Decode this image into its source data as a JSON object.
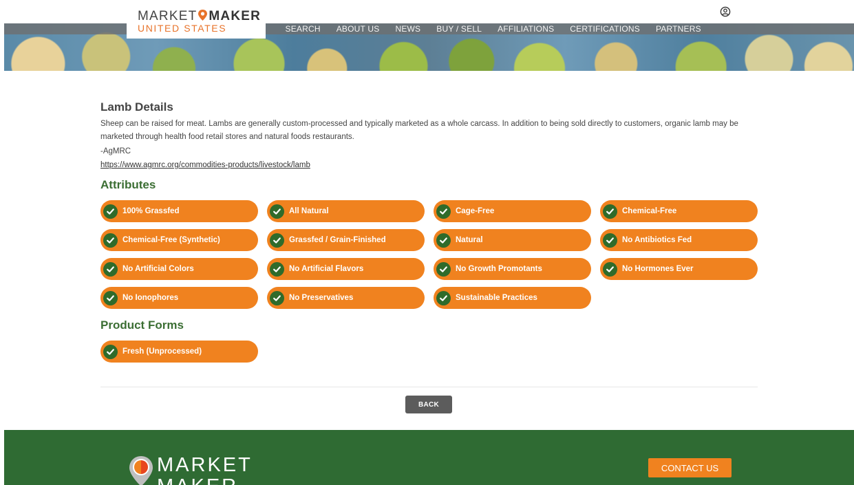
{
  "header": {
    "logo_top_left": "MARKET",
    "logo_top_right": "MAKER",
    "logo_bottom": "UNITED STATES",
    "nav": [
      "SEARCH",
      "ABOUT US",
      "NEWS",
      "BUY / SELL",
      "AFFILIATIONS",
      "CERTIFICATIONS",
      "PARTNERS"
    ],
    "user_icon": "user-circle-icon"
  },
  "main": {
    "title": "Lamb Details",
    "description": "Sheep can be raised for meat. Lambs are generally custom-processed and typically marketed as a whole carcass.  In addition to being sold directly to customers, organic lamb may be marketed through health food retail stores and natural foods restaurants.",
    "source": "-AgMRC",
    "link": "https://www.agmrc.org/commodities-products/livestock/lamb",
    "attributes_title": "Attributes",
    "attributes": [
      "100% Grassfed",
      "All Natural",
      "Cage-Free",
      "Chemical-Free",
      "Chemical-Free (Synthetic)",
      "Grassfed / Grain-Finished",
      "Natural",
      "No Antibiotics Fed",
      "No Artificial Colors",
      "No Artificial Flavors",
      "No Growth Promotants",
      "No Hormones Ever",
      "No Ionophores",
      "No Preservatives",
      "Sustainable Practices"
    ],
    "forms_title": "Product Forms",
    "forms": [
      "Fresh (Unprocessed)"
    ],
    "back_label": "BACK"
  },
  "footer": {
    "logo_line1": "MARKET",
    "logo_line2": "MAKER",
    "contact_label": "CONTACT US"
  },
  "colors": {
    "accent_orange": "#f0821f",
    "check_green": "#2f6b2b",
    "section_green": "#3b6e33",
    "footer_green": "#2f6b33"
  }
}
